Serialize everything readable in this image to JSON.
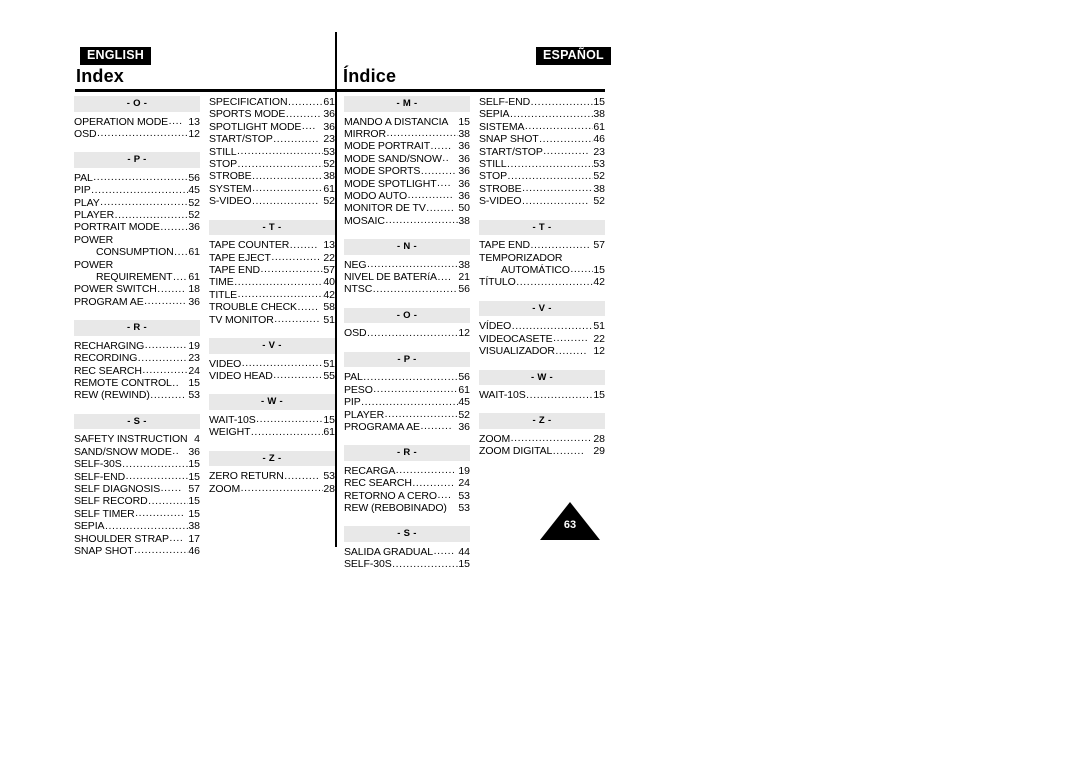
{
  "page": {
    "number": "63",
    "english": {
      "badge": "ENGLISH",
      "title": "Index"
    },
    "spanish": {
      "badge": "ESPAÑOL",
      "title": "Índice"
    }
  },
  "columns": [
    {
      "id": "col-1",
      "sections": [
        {
          "letter": "- O -",
          "entries": [
            {
              "term": "OPERATION MODE",
              "leader": "....",
              "page": "13"
            },
            {
              "term": "OSD",
              "leader": "..............................",
              "page": "12"
            }
          ]
        },
        {
          "letter": "- P -",
          "entries": [
            {
              "term": "PAL",
              "leader": "..............................",
              "page": "56"
            },
            {
              "term": "PIP",
              "leader": "................................",
              "page": "45"
            },
            {
              "term": "PLAY",
              "leader": "............................",
              "page": "52"
            },
            {
              "term": "PLAYER",
              "leader": "........................",
              "page": "52"
            },
            {
              "term": "PORTRAIT MODE",
              "leader": "........",
              "page": "36"
            },
            {
              "term": "POWER",
              "leader": "",
              "page": ""
            },
            {
              "term": "CONSUMPTION",
              "leader": "....",
              "page": "61",
              "cont": true
            },
            {
              "term": "POWER",
              "leader": "",
              "page": ""
            },
            {
              "term": "REQUIREMENT",
              "leader": "......",
              "page": "61",
              "cont": true
            },
            {
              "term": "POWER SWITCH",
              "leader": "........",
              "page": "18"
            },
            {
              "term": "PROGRAM AE",
              "leader": "............",
              "page": "36"
            }
          ]
        },
        {
          "letter": "- R -",
          "entries": [
            {
              "term": "RECHARGING",
              "leader": "............",
              "page": "19"
            },
            {
              "term": "RECORDING",
              "leader": "................",
              "page": "23"
            },
            {
              "term": "REC SEARCH",
              "leader": "...............",
              "page": "24"
            },
            {
              "term": "REMOTE CONTROL",
              "leader": "..",
              "page": "15"
            },
            {
              "term": "REW (REWIND)",
              "leader": "..........",
              "page": "53"
            }
          ]
        },
        {
          "letter": "- S -",
          "entries": [
            {
              "term": "SAFETY INSTRUCTION",
              "leader": "",
              "page": "4"
            },
            {
              "term": "SAND/SNOW MODE",
              "leader": "..",
              "page": "36"
            },
            {
              "term": "SELF-30S",
              "leader": ".....................",
              "page": "15"
            },
            {
              "term": "SELF-END",
              "leader": "...................",
              "page": "15"
            },
            {
              "term": "SELF DIAGNOSIS",
              "leader": "......",
              "page": "57"
            },
            {
              "term": "SELF RECORD",
              "leader": "............",
              "page": "15"
            },
            {
              "term": "SELF TIMER",
              "leader": "..............",
              "page": "15"
            },
            {
              "term": "SEPIA",
              "leader": "...........................",
              "page": "38"
            },
            {
              "term": "SHOULDER STRAP",
              "leader": "....",
              "page": "17"
            },
            {
              "term": "SNAP SHOT",
              "leader": "................",
              "page": "46"
            }
          ]
        }
      ]
    },
    {
      "id": "col-2",
      "sections": [
        {
          "letter": "",
          "entries": [
            {
              "term": "SPECIFICATION",
              "leader": "..........",
              "page": "61"
            },
            {
              "term": "SPORTS MODE",
              "leader": "..........",
              "page": "36"
            },
            {
              "term": "SPOTLIGHT MODE",
              "leader": "....",
              "page": "36"
            },
            {
              "term": "START/STOP",
              "leader": ".............",
              "page": "23"
            },
            {
              "term": "STILL",
              "leader": "..........................",
              "page": "53"
            },
            {
              "term": "STOP",
              "leader": "..........................",
              "page": "52"
            },
            {
              "term": "STROBE",
              "leader": "....................",
              "page": "38"
            },
            {
              "term": "SYSTEM",
              "leader": "....................",
              "page": "61"
            },
            {
              "term": "S-VIDEO",
              "leader": "...................",
              "page": "52"
            }
          ]
        },
        {
          "letter": "- T -",
          "entries": [
            {
              "term": "TAPE COUNTER",
              "leader": "........",
              "page": "13"
            },
            {
              "term": "TAPE EJECT",
              "leader": "..............",
              "page": "22"
            },
            {
              "term": "TAPE END",
              "leader": "..................",
              "page": "57"
            },
            {
              "term": "TIME",
              "leader": "..........................",
              "page": "40"
            },
            {
              "term": "TITLE",
              "leader": "..........................",
              "page": "42"
            },
            {
              "term": "TROUBLE CHECK",
              "leader": "......",
              "page": "58"
            },
            {
              "term": "TV MONITOR",
              "leader": ".............",
              "page": "51"
            }
          ]
        },
        {
          "letter": "- V -",
          "entries": [
            {
              "term": "VIDEO",
              "leader": ".........................",
              "page": "51"
            },
            {
              "term": "VIDEO HEAD",
              "leader": "..............",
              "page": "55"
            }
          ]
        },
        {
          "letter": "- W -",
          "entries": [
            {
              "term": "WAIT-10S",
              "leader": "....................",
              "page": "15"
            },
            {
              "term": "WEIGHT",
              "leader": "......................",
              "page": "61"
            }
          ]
        },
        {
          "letter": "- Z -",
          "entries": [
            {
              "term": "ZERO RETURN",
              "leader": "..........",
              "page": "53"
            },
            {
              "term": "ZOOM",
              "leader": "........................",
              "page": "28"
            }
          ]
        }
      ]
    },
    {
      "id": "col-3",
      "sections": [
        {
          "letter": "- M -",
          "entries": [
            {
              "term": "MANDO A DISTANCIA",
              "leader": "",
              "page": "15"
            },
            {
              "term": "MIRROR",
              "leader": ".....................",
              "page": "38"
            },
            {
              "term": "MODE PORTRAIT",
              "leader": "......",
              "page": "36"
            },
            {
              "term": "MODE SAND/SNOW",
              "leader": "..",
              "page": "36"
            },
            {
              "term": "MODE SPORTS",
              "leader": "..........",
              "page": "36"
            },
            {
              "term": "MODE SPOTLIGHT",
              "leader": "....",
              "page": "36"
            },
            {
              "term": "MODO AUTO",
              "leader": ".............",
              "page": "36"
            },
            {
              "term": "MONITOR DE TV",
              "leader": "........",
              "page": "50"
            },
            {
              "term": "MOSAIC",
              "leader": "......................",
              "page": "38"
            }
          ]
        },
        {
          "letter": "- N -",
          "entries": [
            {
              "term": "NEG",
              "leader": "..............................",
              "page": "38"
            },
            {
              "term": "NIVEL DE BATERíA",
              "leader": "....",
              "page": "21"
            },
            {
              "term": "NTSC",
              "leader": ".........................",
              "page": "56"
            }
          ]
        },
        {
          "letter": "- O -",
          "entries": [
            {
              "term": "OSD",
              "leader": "...........................",
              "page": "12"
            }
          ]
        },
        {
          "letter": "- P -",
          "entries": [
            {
              "term": "PAL",
              "leader": "..............................",
              "page": "56"
            },
            {
              "term": "PESO",
              "leader": "..........................",
              "page": "61"
            },
            {
              "term": "PIP",
              "leader": "...............................",
              "page": "45"
            },
            {
              "term": "PLAYER",
              "leader": "......................",
              "page": "52"
            },
            {
              "term": "PROGRAMA AE",
              "leader": ".........",
              "page": "36"
            }
          ]
        },
        {
          "letter": "- R -",
          "entries": [
            {
              "term": "RECARGA",
              "leader": ".................",
              "page": "19"
            },
            {
              "term": "REC SEARCH",
              "leader": "............",
              "page": "24"
            },
            {
              "term": "RETORNO A CERO",
              "leader": "....",
              "page": "53"
            },
            {
              "term": "REW (REBOBINADO)",
              "leader": "",
              "page": "53"
            }
          ]
        },
        {
          "letter": "- S -",
          "entries": [
            {
              "term": "SALIDA GRADUAL",
              "leader": "......",
              "page": "44"
            },
            {
              "term": "SELF-30S",
              "leader": "...................",
              "page": "15"
            }
          ]
        }
      ]
    },
    {
      "id": "col-4",
      "sections": [
        {
          "letter": "",
          "entries": [
            {
              "term": "SELF-END",
              "leader": "..................",
              "page": "15"
            },
            {
              "term": "SEPIA",
              "leader": ".........................",
              "page": "38"
            },
            {
              "term": "SISTEMA",
              "leader": ".....................",
              "page": "61"
            },
            {
              "term": "SNAP SHOT",
              "leader": "................",
              "page": "46"
            },
            {
              "term": "START/STOP",
              "leader": ".............",
              "page": "23"
            },
            {
              "term": "STILL",
              "leader": ".........................",
              "page": "53"
            },
            {
              "term": "STOP",
              "leader": ".........................",
              "page": "52"
            },
            {
              "term": "STROBE",
              "leader": "....................",
              "page": "38"
            },
            {
              "term": "S-VIDEO",
              "leader": "...................",
              "page": "52"
            }
          ]
        },
        {
          "letter": "- T -",
          "entries": [
            {
              "term": "TAPE END",
              "leader": ".................",
              "page": "57"
            },
            {
              "term": "TEMPORIZADOR",
              "leader": "",
              "page": ""
            },
            {
              "term": "AUTOMÁTICO",
              "leader": ".......",
              "page": "15",
              "cont": true
            },
            {
              "term": "TÍTULO",
              "leader": "......................",
              "page": "42"
            }
          ]
        },
        {
          "letter": "- V -",
          "entries": [
            {
              "term": "VÍDEO",
              "leader": ".........................",
              "page": "51"
            },
            {
              "term": "VIDEOCASETE",
              "leader": "..........",
              "page": "22"
            },
            {
              "term": "VISUALIZADOR",
              "leader": ".........",
              "page": "12"
            }
          ]
        },
        {
          "letter": "- W -",
          "entries": [
            {
              "term": "WAIT-10S",
              "leader": "...................",
              "page": "15"
            }
          ]
        },
        {
          "letter": "- Z -",
          "entries": [
            {
              "term": "ZOOM",
              "leader": ".......................",
              "page": "28"
            },
            {
              "term": "ZOOM DIGITAL",
              "leader": ".........",
              "page": "29"
            }
          ]
        }
      ]
    }
  ]
}
